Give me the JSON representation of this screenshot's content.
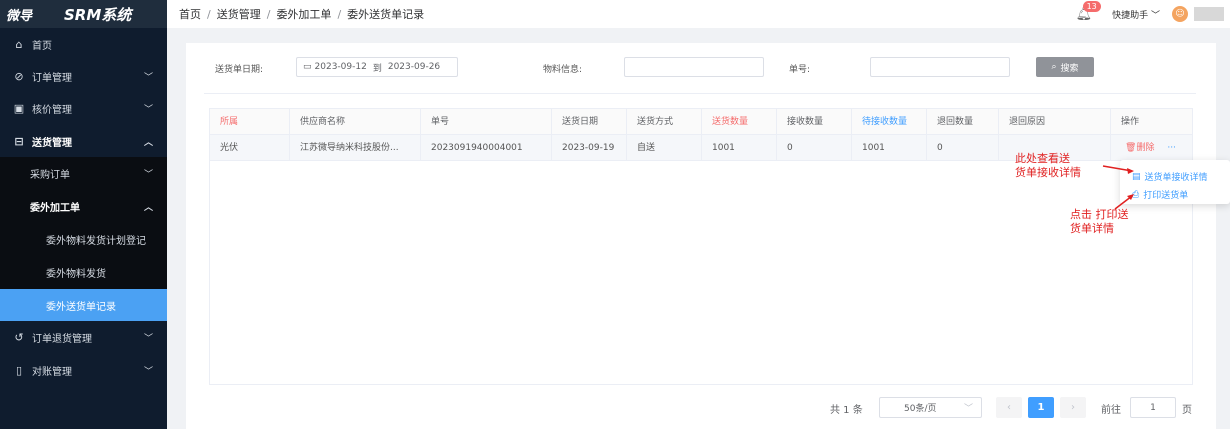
{
  "brand": {
    "logo": "微导",
    "system": "SRM系统"
  },
  "sidebar": {
    "items": [
      {
        "label": "首页",
        "icon": "home-icon"
      },
      {
        "label": "订单管理",
        "icon": "check-circle-icon"
      },
      {
        "label": "核价管理",
        "icon": "calculator-icon"
      },
      {
        "label": "送货管理",
        "icon": "truck-icon"
      },
      {
        "label": "采购订单"
      },
      {
        "label": "委外加工单"
      },
      {
        "label": "委外物料发货计划登记"
      },
      {
        "label": "委外物料发货"
      },
      {
        "label": "委外送货单记录"
      },
      {
        "label": "订单退货管理",
        "icon": "return-icon"
      },
      {
        "label": "对账管理",
        "icon": "ledger-icon"
      }
    ]
  },
  "breadcrumb": [
    "首页",
    "送货管理",
    "委外加工单",
    "委外送货单记录"
  ],
  "header": {
    "badge_count": "13",
    "helper": "快捷助手"
  },
  "filters": {
    "date_label": "送货单日期:",
    "date_start": "2023-09-12",
    "date_to": "到",
    "date_end": "2023-09-26",
    "material_label": "物料信息:",
    "number_label": "单号:",
    "search_label": "搜索"
  },
  "table": {
    "headers": [
      "所属",
      "供应商名称",
      "单号",
      "送货日期",
      "送货方式",
      "送货数量",
      "接收数量",
      "待接收数量",
      "退回数量",
      "退回原因",
      "操作"
    ],
    "rows": [
      {
        "belong": "光伏",
        "supplier": "江苏微导纳米科技股份...",
        "number": "2023091940004001",
        "date": "2023-09-19",
        "method": "自送",
        "qty_sent": "1001",
        "qty_received": "0",
        "qty_pending": "1001",
        "qty_returned": "0",
        "reason": "",
        "delete": "删除",
        "more": "···"
      }
    ]
  },
  "dropdown": {
    "item1": "送货单接收详情",
    "item2": "打印送货单"
  },
  "annotations": {
    "a1_line1": "此处查看送",
    "a1_line2": "货单接收详情",
    "a2_line1": "点击 打印送",
    "a2_line2": "货单详情"
  },
  "pagination": {
    "total": "共 1 条",
    "page_size": "50条/页",
    "current": "1",
    "goto_label": "前往",
    "goto_value": "1",
    "page_unit": "页"
  },
  "colors": {
    "accent": "#409eff",
    "danger": "#f56c6c",
    "sidebar": "#0f1c2e"
  }
}
